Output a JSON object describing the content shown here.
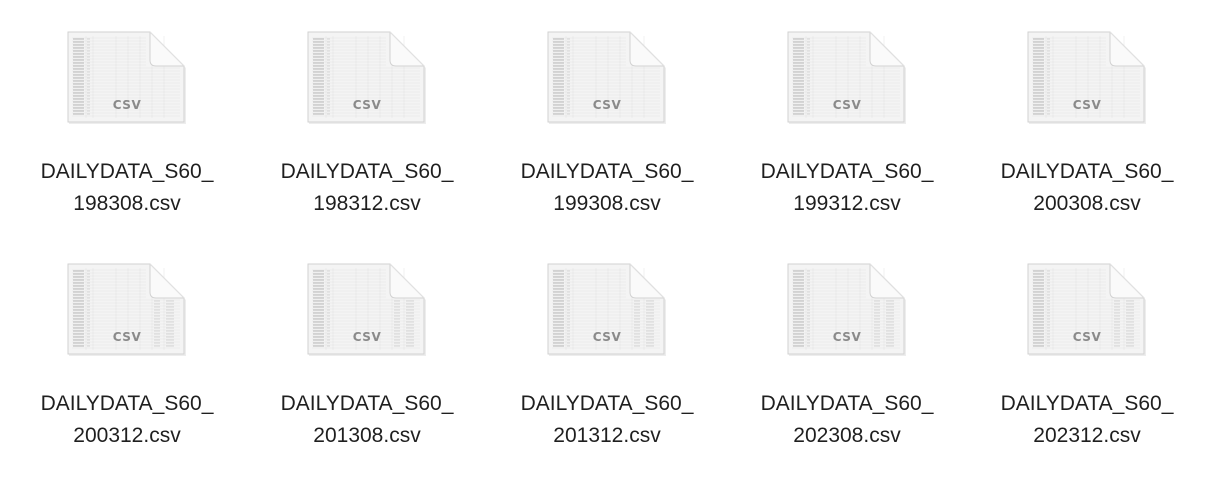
{
  "files": [
    {
      "name_line1": "DAILYDATA_S60_",
      "name_line2": "198308.csv",
      "icon": "csv-file-icon",
      "icon_badge": "CSV"
    },
    {
      "name_line1": "DAILYDATA_S60_",
      "name_line2": "198312.csv",
      "icon": "csv-file-icon",
      "icon_badge": "CSV"
    },
    {
      "name_line1": "DAILYDATA_S60_",
      "name_line2": "199308.csv",
      "icon": "csv-file-icon",
      "icon_badge": "CSV"
    },
    {
      "name_line1": "DAILYDATA_S60_",
      "name_line2": "199312.csv",
      "icon": "csv-file-icon",
      "icon_badge": "CSV"
    },
    {
      "name_line1": "DAILYDATA_S60_",
      "name_line2": "200308.csv",
      "icon": "csv-file-icon",
      "icon_badge": "CSV"
    },
    {
      "name_line1": "DAILYDATA_S60_",
      "name_line2": "200312.csv",
      "icon": "csv-file-icon",
      "icon_badge": "CSV"
    },
    {
      "name_line1": "DAILYDATA_S60_",
      "name_line2": "201308.csv",
      "icon": "csv-file-icon",
      "icon_badge": "CSV"
    },
    {
      "name_line1": "DAILYDATA_S60_",
      "name_line2": "201312.csv",
      "icon": "csv-file-icon",
      "icon_badge": "CSV"
    },
    {
      "name_line1": "DAILYDATA_S60_",
      "name_line2": "202308.csv",
      "icon": "csv-file-icon",
      "icon_badge": "CSV"
    },
    {
      "name_line1": "DAILYDATA_S60_",
      "name_line2": "202312.csv",
      "icon": "csv-file-icon",
      "icon_badge": "CSV"
    }
  ],
  "colors": {
    "background": "#ffffff",
    "label_text": "#1f1f1f",
    "icon_paper": "#f4f4f4",
    "icon_border": "#d2d2d2",
    "icon_badge_text": "#8a8a8a"
  }
}
